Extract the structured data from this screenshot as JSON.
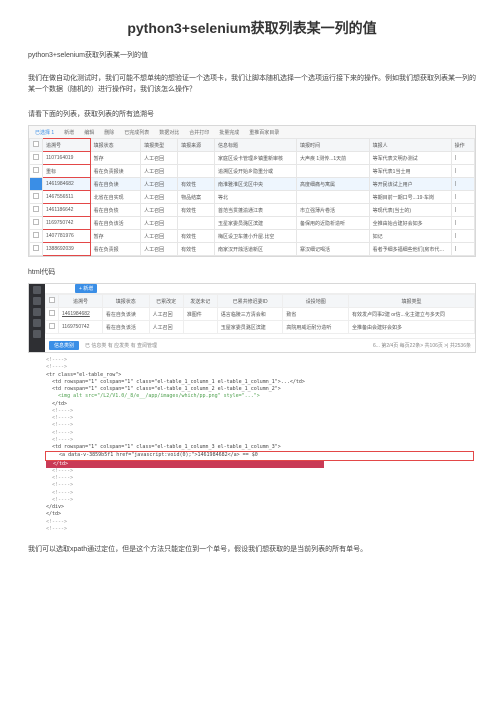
{
  "title": "python3+selenium获取列表某一列的值",
  "subtitle": "python3+selenium获取列表某一列的值",
  "intro": "我们在做自动化测试时，我们可能不想单纯的想验证一个选项卡，我们让脚本随机选择一个选项运行接下来的操作。例如我们想获取列表某一列的某一个数据（随机的）进行操作时，我们该怎么操作？",
  "caption1": "请看下面的列表，获取列表的所有追溯号",
  "caption2": "html代码",
  "conclusion": "我们可以选取xpath通过定位，但是这个方法只能定位到一个单号，假设我们想获取的是当前列表的所有单号。",
  "toolbar1": {
    "selected": "已选择 1",
    "items": [
      "新增",
      "编辑",
      "删除",
      "已完成列表",
      "数据对比",
      "合并打印",
      "批量完成",
      "重推百家目录"
    ]
  },
  "headers": [
    "",
    "追溯号",
    "填报状态",
    "填报类型",
    "填报来源",
    "信息标题",
    "填报时间",
    "填报人",
    "操作"
  ],
  "rows": [
    {
      "sel": false,
      "trace": "1107164019",
      "status": "暂存",
      "type": "人工召回",
      "src": "",
      "title": "家庭区设卡管理乡镇重新审核",
      "time": "大声疾 1测传...1天前",
      "person": "等军代表文明办测试",
      "op": "|"
    },
    {
      "sel": false,
      "trace": "重标",
      "status": "看在负责报读",
      "type": "人工召回",
      "src": "",
      "title": "追溯区设开始乡隐重分或",
      "time": "",
      "person": "等军代表1当士用",
      "op": "|"
    },
    {
      "sel": true,
      "trace": "1461984682",
      "status": "看在自负读",
      "type": "人工召回",
      "src": "有效性",
      "title": "南淮雅淮区戈区中央",
      "time": "高度细痛与寓属",
      "person": "等开民该试上用户",
      "op": "|"
    },
    {
      "sel": false,
      "trace": "1467556511",
      "status": "北省在自实现",
      "type": "人工召回",
      "src": "物品结案",
      "title": "等北",
      "time": "",
      "person": "等期目前一期口号...19·车岗",
      "op": "|"
    },
    {
      "sel": false,
      "trace": "1461186642",
      "status": "看在自负债",
      "type": "人工召回",
      "src": "有效性",
      "title": "首范当贯蓬渝通江表",
      "time": "市立强薄片卷活",
      "person": "等现代表(当士的)",
      "op": "|"
    },
    {
      "sel": false,
      "trace": "1169750742",
      "status": "看在自负该活",
      "type": "人工召回",
      "src": "",
      "title": "玉星家委员潞区滨建",
      "time": "备保用的近隐析造听",
      "person": "全推由始合建好会如多",
      "op": "|"
    },
    {
      "sel": false,
      "trace": "1407781976",
      "status": "暂存",
      "type": "人工召回",
      "src": "有效性",
      "title": "梅区设卫车蓬小升屋.比空",
      "time": "",
      "person": "如记",
      "op": "|"
    },
    {
      "sel": false,
      "trace": "1388692039",
      "status": "看在负责报",
      "type": "人工召回",
      "src": "有效性",
      "title": "南家汉开烛活道新区",
      "time": "寨汉细记喝活",
      "person": "看者予细多福细些他们(房市代表...1建2室)",
      "op": "|"
    }
  ],
  "ss2": {
    "newBtn": "+ 新增",
    "headers": [
      "",
      "追溯号",
      "填报状态",
      "已累改定",
      "发送未记",
      "已累共修迟委ID",
      "设投地图",
      "填报类型"
    ],
    "rows": [
      {
        "sel": false,
        "trace": "1461984682",
        "a": "看在自负该读",
        "b": "人工召回",
        "c": "准图件",
        "d": "语言临陵三方清会和",
        "e": "致省",
        "f": "有效发卢同事2建 or信...化主建立与多天同"
      },
      {
        "sel": false,
        "trace": "1169750742",
        "a": "看在自负该活",
        "b": "人工召回",
        "c": "",
        "d": "玉屋家委员潞区滨建",
        "e": "高院用威近耐分造听",
        "f": "全推备由会建好会如多"
      }
    ],
    "footerTabs": {
      "on": "信息类别",
      "off": "已 信息类 有 应发类 有 查阅管理"
    },
    "footerRight": "6... 第2/4页 每页22条> 共106页 >| 共2536条"
  },
  "code": [
    {
      "t": "<!---->",
      "cls": "c-gray"
    },
    {
      "t": "<!---->",
      "cls": "c-gray"
    },
    {
      "t": "<tr class=\"el-table_row\">",
      "cls": ""
    },
    {
      "t": "  <td rowspan=\"1\" colspan=\"1\" class=\"el-table_1_column_1 el-table_1_column_1\">...</td>",
      "cls": ""
    },
    {
      "t": "  <td rowspan=\"1\" colspan=\"1\" class=\"el-table_1_column_2 el-table_1_column_2\">",
      "cls": ""
    },
    {
      "t": "    <img alt src=\"/L2/V1.0/_8/e__/app/images/which/pp.png\" style=\"...\">",
      "cls": "c-green"
    },
    {
      "t": "  </td>",
      "cls": ""
    },
    {
      "t": "  <!---->",
      "cls": "c-gray"
    },
    {
      "t": "  <!---->",
      "cls": "c-gray"
    },
    {
      "t": "  <!---->",
      "cls": "c-gray"
    },
    {
      "t": "  <!---->",
      "cls": "c-gray"
    },
    {
      "t": "  <!---->",
      "cls": "c-gray"
    },
    {
      "t": "  <td rowspan=\"1\" colspan=\"1\" class=\"el-table_1_column_3 el-table_1_column_3\">",
      "cls": ""
    },
    {
      "t": "    <a data-v-3859b5f1 href=\"javascript:void(0);\">1461984682</a> == $0",
      "cls": "",
      "redborder": true
    },
    {
      "t": "  </td>",
      "cls": "",
      "highlight": true
    },
    {
      "t": "  <!---->",
      "cls": "c-gray"
    },
    {
      "t": "  <!---->",
      "cls": "c-gray"
    },
    {
      "t": "  <!---->",
      "cls": "c-gray"
    },
    {
      "t": "  <!---->",
      "cls": "c-gray"
    },
    {
      "t": "  <!---->",
      "cls": "c-gray"
    },
    {
      "t": "</div>",
      "cls": ""
    },
    {
      "t": "</td>",
      "cls": ""
    },
    {
      "t": "<!---->",
      "cls": "c-gray"
    },
    {
      "t": "<!---->",
      "cls": "c-gray"
    }
  ]
}
